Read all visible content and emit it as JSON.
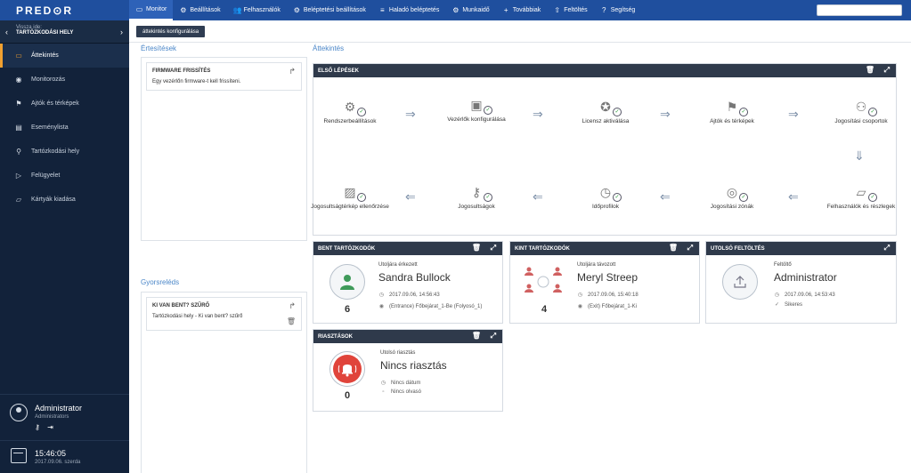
{
  "app": {
    "logo": "PRED⊙R"
  },
  "nav": [
    {
      "icon": "▭",
      "label": "Monitor",
      "active": true
    },
    {
      "icon": "⚙",
      "label": "Beállítások"
    },
    {
      "icon": "👥",
      "label": "Felhasználók"
    },
    {
      "icon": "⚙",
      "label": "Beléptetési beállítások"
    },
    {
      "icon": "≡",
      "label": "Haladó beléptetés"
    },
    {
      "icon": "⚙",
      "label": "Munkaidő"
    },
    {
      "icon": "+",
      "label": "Továbbiak"
    },
    {
      "icon": "⇧",
      "label": "Feltöltés"
    },
    {
      "icon": "?",
      "label": "Segítség"
    }
  ],
  "search": {
    "placeholder": ""
  },
  "sidebar": {
    "back_label": "Vissza ide:",
    "back_title": "TARTÓZKODÁSI HELY",
    "items": [
      {
        "icon": "▭",
        "label": "Áttekintés",
        "active": true
      },
      {
        "icon": "◉",
        "label": "Monitorozás"
      },
      {
        "icon": "⚑",
        "label": "Ajtók és térképek"
      },
      {
        "icon": "▤",
        "label": "Eseménylista"
      },
      {
        "icon": "⚲",
        "label": "Tartózkodási hely"
      },
      {
        "icon": "▷",
        "label": "Felügyelet"
      },
      {
        "icon": "▱",
        "label": "Kártyák kiadása"
      }
    ],
    "user_name": "Administrator",
    "user_role": "Administrators",
    "user_icons": "⚷ ⇥",
    "time": "15:46:05",
    "date": "2017.09.06. szerda"
  },
  "main": {
    "config_button": "áttekintés konfigurálása",
    "notifications_title": "Értesítések",
    "notification": {
      "title": "FIRMWARE FRISSÍTÉS",
      "text": "Egy vezérlőn firmware-t kell frissíteni."
    },
    "quick_title": "Gyorsreléds",
    "quick_filter": {
      "title": "KI VAN BENT? SZŰRŐ",
      "text": "Tartózkodási hely - Ki van bent? szűrő"
    },
    "overview_title": "Áttekintés",
    "first_steps": {
      "title": "ELSŐ LÉPÉSEK",
      "row1": [
        {
          "icon": "⚙",
          "label": "Rendszerbeállítások"
        },
        {
          "icon": "▣",
          "label": "Vezérlők konfigurálása"
        },
        {
          "icon": "✪",
          "label": "Licensz aktiválása"
        },
        {
          "icon": "⚑",
          "label": "Ajtók és térképek"
        },
        {
          "icon": "⚇",
          "label": "Jogosítási csoportok"
        }
      ],
      "row2": [
        {
          "icon": "▱",
          "label": "Felhasználók és részlegek"
        },
        {
          "icon": "◎",
          "label": "Jogosítási zónák"
        },
        {
          "icon": "◷",
          "label": "Időprofilok"
        },
        {
          "icon": "⚷",
          "label": "Jogosultságok"
        },
        {
          "icon": "▨",
          "label": "Jogosultságtérkép ellenőrzése"
        }
      ],
      "check": "✓"
    },
    "inside": {
      "title": "BENT TARTÓZKODÓK",
      "count": "6",
      "sub": "Utoljára érkezett",
      "name": "Sandra Bullock",
      "time": "2017.09.06, 14:56:43",
      "place": "(Entrance) Főbejárat_1-Be (Folyosó_1)"
    },
    "outside": {
      "title": "KINT TARTÓZKODÓK",
      "count": "4",
      "sub": "Utoljára távozott",
      "name": "Meryl Streep",
      "time": "2017.09.06, 15:40:18",
      "place": "(Exit) Főbejárat_1-Ki"
    },
    "upload": {
      "title": "UTOLSÓ FELTÖLTÉS",
      "sub": "Feltöltő",
      "name": "Administrator",
      "time": "2017.09.06, 14:53:43",
      "status": "Sikeres"
    },
    "alarms": {
      "title": "RIASZTÁSOK",
      "count": "0",
      "sub": "Utolsó riasztás",
      "name": "Nincs riasztás",
      "date": "Nincs dátum",
      "reader": "Nincs olvasó"
    }
  },
  "colors": {
    "topbar": "#1f4f9e",
    "sidebar": "#12223a",
    "accent": "#f0a030",
    "alarm": "#e0443b",
    "inside": "#3f9a5a",
    "outside": "#d06060"
  }
}
